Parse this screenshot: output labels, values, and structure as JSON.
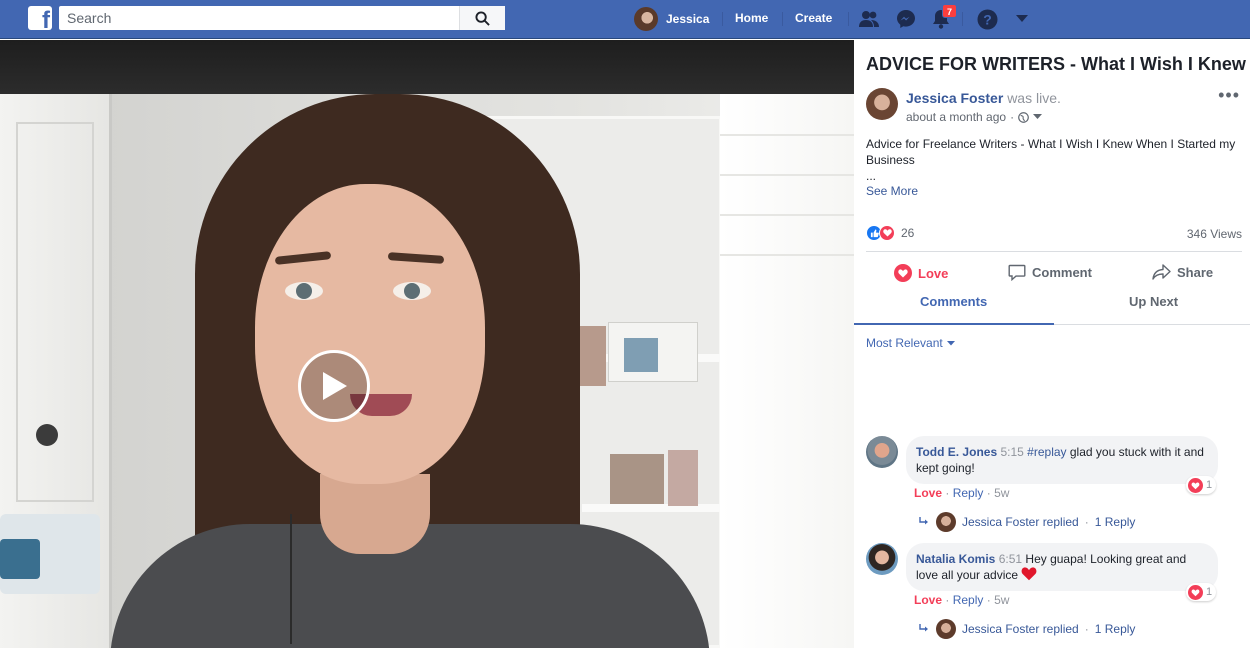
{
  "topbar": {
    "search_placeholder": "Search",
    "user_name": "Jessica",
    "home_label": "Home",
    "create_label": "Create",
    "notification_count": "7",
    "colors": {
      "bar": "#4267b2",
      "badge": "#fa3e3e"
    }
  },
  "post": {
    "title": "ADVICE FOR WRITERS - What I Wish I Knew",
    "author": "Jessica Foster",
    "status": "was live.",
    "time": "about a month ago",
    "text_line1": "Advice for Freelance Writers - What I Wish I Knew When I Started my Business",
    "ellipsis": "...",
    "see_more": "See More",
    "reaction_count": "26",
    "views": "346 Views"
  },
  "actions": {
    "love": "Love",
    "comment": "Comment",
    "share": "Share"
  },
  "tabs": {
    "comments": "Comments",
    "up_next": "Up Next"
  },
  "sort_label": "Most Relevant",
  "comments": [
    {
      "name": "Todd E. Jones",
      "timestamp": "5:15",
      "hashtag": "#replay",
      "text": "glad you stuck with it and kept going!",
      "love": "Love",
      "reply": "Reply",
      "age": "5w",
      "reaction_count": "1",
      "replied_by": "Jessica Foster replied",
      "reply_count": "1 Reply"
    },
    {
      "name": "Natalia Komis",
      "timestamp": "6:51",
      "text": "Hey guapa! Looking great and love all your advice",
      "love": "Love",
      "reply": "Reply",
      "age": "5w",
      "reaction_count": "1",
      "replied_by": "Jessica Foster replied",
      "reply_count": "1 Reply"
    }
  ],
  "separator": "·"
}
